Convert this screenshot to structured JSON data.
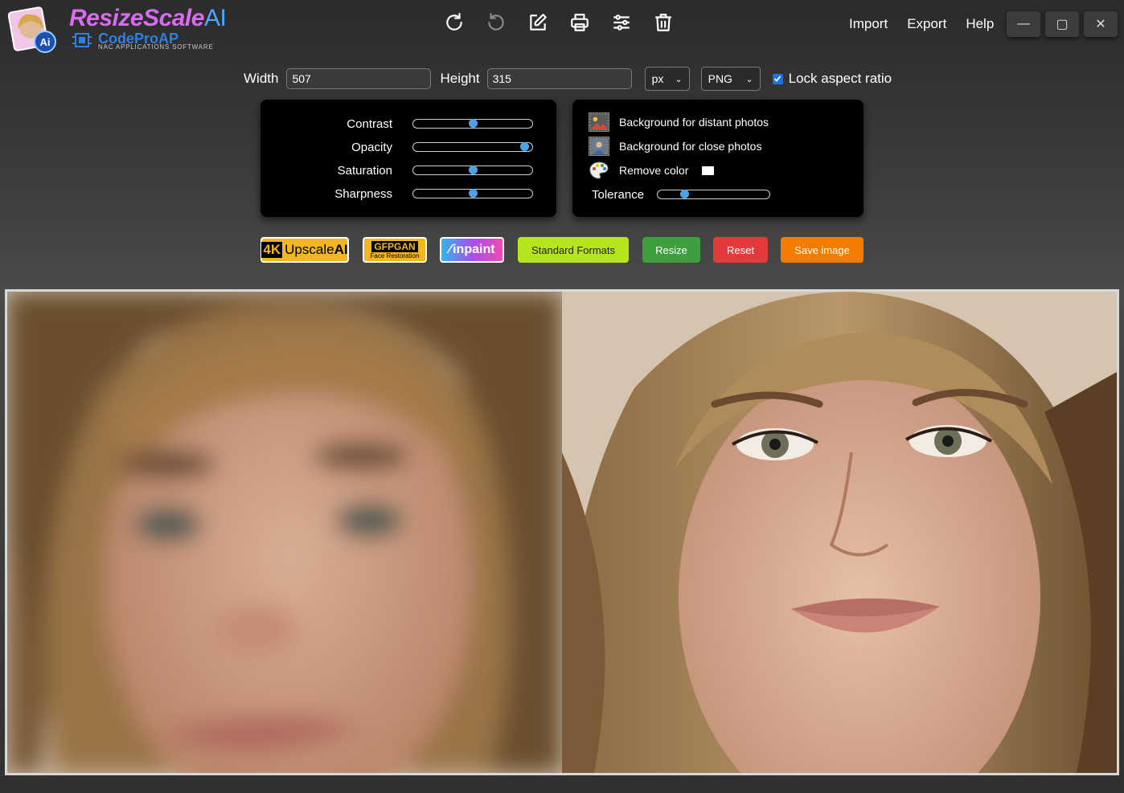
{
  "app": {
    "title_part1": "ResizeScale",
    "title_part2": "AI",
    "brand": "CodeProAP",
    "brand_sub": "NAC APPLICATIONS SOFTWARE"
  },
  "toolbar": [
    {
      "name": "rotate-right-icon"
    },
    {
      "name": "rotate-left-icon"
    },
    {
      "name": "edit-icon"
    },
    {
      "name": "print-icon"
    },
    {
      "name": "sliders-icon"
    },
    {
      "name": "trash-icon"
    }
  ],
  "menu": {
    "import": "Import",
    "export": "Export",
    "help": "Help"
  },
  "window": {
    "minimize": "—",
    "maximize": "▢",
    "close": "✕"
  },
  "size": {
    "width_label": "Width",
    "width_value": "507",
    "height_label": "Height",
    "height_value": "315",
    "unit": "px",
    "format": "PNG",
    "lock_label": "Lock aspect ratio",
    "lock_checked": true
  },
  "adjust": {
    "contrast_label": "Contrast",
    "contrast_value": 0.5,
    "opacity_label": "Opacity",
    "opacity_value": 0.93,
    "saturation_label": "Saturation",
    "saturation_value": 0.5,
    "sharpness_label": "Sharpness",
    "sharpness_value": 0.5
  },
  "background": {
    "distant_label": "Background for distant photos",
    "close_label": "Background for close photos",
    "remove_color_label": "Remove color",
    "remove_color_swatch": "#ffffff",
    "tolerance_label": "Tolerance",
    "tolerance_value": 0.24
  },
  "actions": {
    "upscale_4k": "4K",
    "upscale_label": "Upscale",
    "upscale_ai": "AI",
    "gfpgan": "GFPGAN",
    "gfpgan_sub": "Face Restoration",
    "inpaint": "inpaint",
    "standard_formats": "Standard Formats",
    "resize": "Resize",
    "reset": "Reset",
    "save_image": "Save image"
  },
  "colors": {
    "standard_formats": "#b5e51d",
    "resize": "#3f9e3f",
    "reset": "#e33b3b",
    "save_image": "#f57c00",
    "accent": "#4aa3e8"
  }
}
